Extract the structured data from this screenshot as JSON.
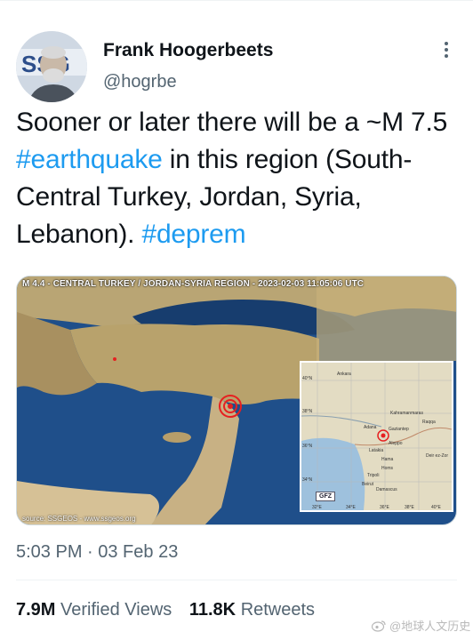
{
  "author": {
    "name": "Frank Hoogerbeets",
    "handle": "@hogrbe",
    "avatar_letters": "SSG"
  },
  "tweet": {
    "text_part1": "Sooner or later there will be a ~M 7.5 ",
    "hashtag1": "#earthquake",
    "text_part2": " in this region (South-Central Turkey, Jordan, Syria, Lebanon). ",
    "hashtag2": "#deprem"
  },
  "media": {
    "caption": "M 4.4 - CENTRAL TURKEY / JORDAN-SYRIA REGION - 2023-02-03 11:05:06 UTC",
    "source": "source: SSGEOS - www.ssgeos.org",
    "inset_places": [
      "Adana",
      "Kahramanmaras",
      "Gaziantep",
      "Aleppo",
      "Latakia",
      "Hama",
      "Homs",
      "Tripoli",
      "Beirut",
      "Damascus",
      "Deir ez-Zor",
      "Raqqa",
      "Ankara"
    ],
    "inset_lat_labels": [
      "40°N",
      "38°N",
      "36°N",
      "34°N"
    ],
    "inset_lon_labels": [
      "32°E",
      "34°E",
      "36°E",
      "38°E",
      "40°E"
    ],
    "inset_logo": "GFZ"
  },
  "meta": {
    "timestamp": "5:03 PM · 03 Feb 23"
  },
  "stats": {
    "views_count": "7.9M",
    "views_label": "Verified Views",
    "retweets_count": "11.8K",
    "retweets_label": "Retweets"
  },
  "watermark": "@地球人文历史",
  "colors": {
    "accent": "#1d9bf0",
    "text_primary": "#0f1419",
    "text_secondary": "#536471",
    "divider": "#eff3f4"
  }
}
